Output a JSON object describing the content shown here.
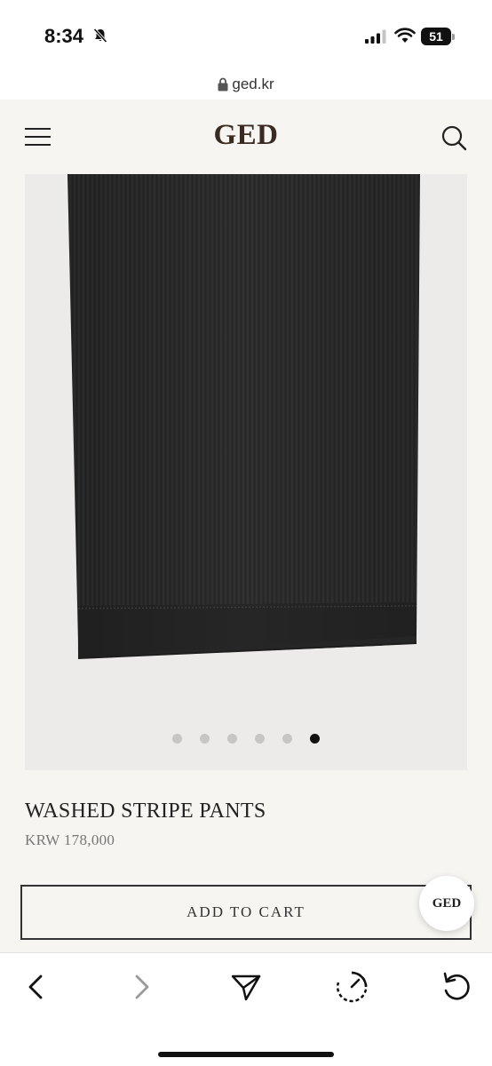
{
  "status_bar": {
    "time": "8:34",
    "battery": "51",
    "bell_icon": "bell-slash-icon",
    "signal_icon": "cellular-signal-icon",
    "wifi_icon": "wifi-icon"
  },
  "url_bar": {
    "url": "ged.kr",
    "lock_icon": "lock-icon"
  },
  "header": {
    "logo": "GED",
    "menu_icon": "hamburger-menu-icon",
    "search_icon": "search-icon"
  },
  "product": {
    "name": "WASHED STRIPE PANTS",
    "price": "KRW 178,000",
    "image_dots": {
      "total": 6,
      "active_index": 5
    }
  },
  "cart": {
    "add_label": "ADD TO CART"
  },
  "chat_badge": {
    "label": "GED"
  },
  "toolbar": {
    "icons": [
      "back-icon",
      "forward-icon",
      "share-icon",
      "speed-icon",
      "reload-icon"
    ]
  },
  "colors": {
    "page_bg": "#f7f5f1",
    "logo": "#3a2b22",
    "image_bg": "#ecebe9",
    "fabric": "#2b2b2b",
    "active_dot": "#111111",
    "inactive_dot": "#c8c6c4"
  }
}
